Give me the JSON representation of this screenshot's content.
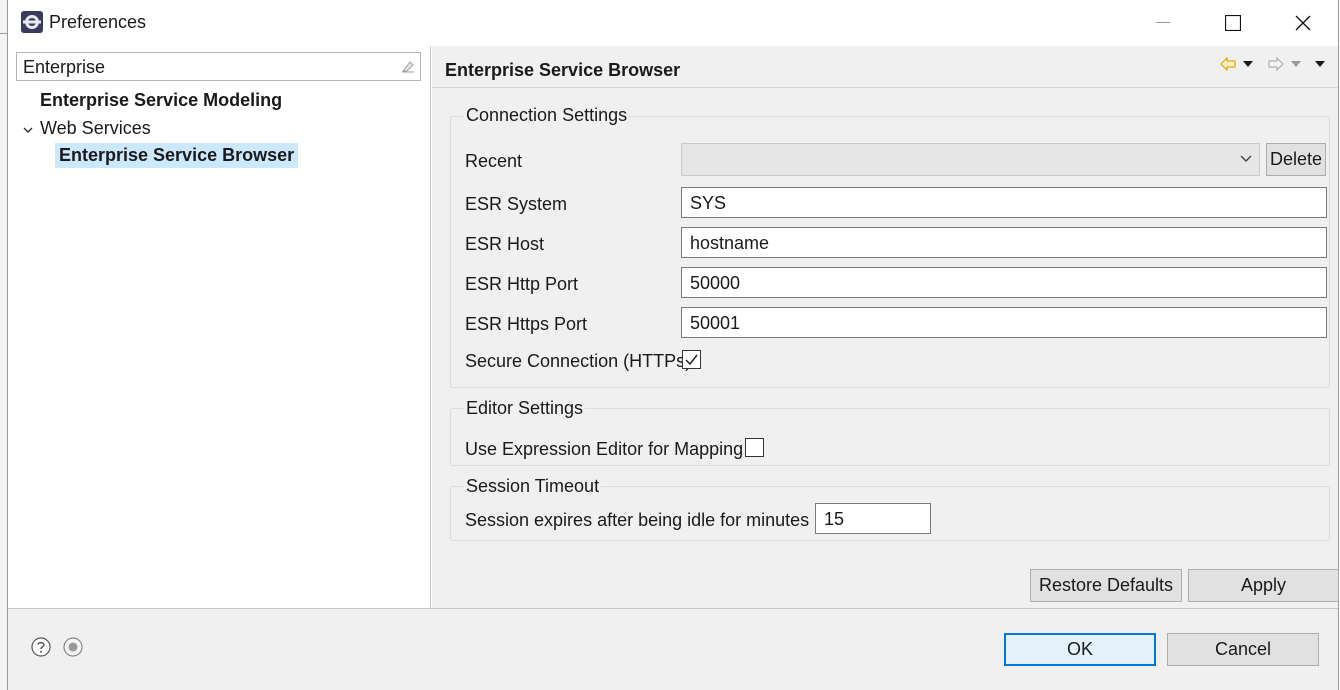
{
  "window": {
    "title": "Preferences",
    "app_icon": "eclipse-icon",
    "controls": [
      "minimize-icon",
      "maximize-icon",
      "close-icon"
    ]
  },
  "sidebar": {
    "filter_value": "Enterprise",
    "items": [
      {
        "label": "Enterprise Service Modeling",
        "bold": true
      },
      {
        "label": "Web Services",
        "expanded": true
      },
      {
        "label": "Enterprise Service Browser",
        "bold": true,
        "selected": true
      }
    ]
  },
  "page": {
    "title": "Enterprise Service Browser",
    "nav_icons": [
      "back-arrow-icon",
      "back-menu-icon",
      "forward-arrow-icon",
      "forward-menu-icon",
      "view-menu-icon"
    ]
  },
  "connection": {
    "group_title": "Connection Settings",
    "recent_label": "Recent",
    "recent_value": "",
    "delete_label": "Delete",
    "esr_system_label": "ESR System",
    "esr_system_value": "SYS",
    "esr_host_label": "ESR Host",
    "esr_host_value": "hostname",
    "http_port_label": "ESR Http Port",
    "http_port_value": "50000",
    "https_port_label": "ESR Https Port",
    "https_port_value": "50001",
    "secure_label": "Secure Connection (HTTPs)",
    "secure_checked": true
  },
  "editor": {
    "group_title": "Editor Settings",
    "expression_label": "Use Expression Editor for Mapping",
    "expression_checked": false
  },
  "session": {
    "group_title": "Session Timeout",
    "idle_label": "Session expires after being idle for  minutes",
    "idle_value": "15"
  },
  "buttons": {
    "restore_defaults": "Restore Defaults",
    "apply": "Apply",
    "ok": "OK",
    "cancel": "Cancel"
  },
  "colors": {
    "selection": "#cce8ff",
    "pane_bg": "#f0f0f0",
    "ok_border": "#0078d7",
    "nav_arrow": "#e8a200"
  }
}
